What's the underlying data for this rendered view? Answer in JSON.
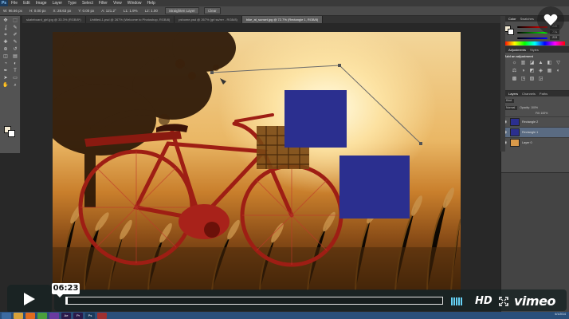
{
  "photoshop": {
    "logo": "Ps",
    "menu": [
      "File",
      "Edit",
      "Image",
      "Layer",
      "Type",
      "Select",
      "Filter",
      "View",
      "Window",
      "Help"
    ],
    "options": {
      "w": "W: 96.66 px",
      "h": "H: 0.00 px",
      "x": "X: 28.63 px",
      "y": "Y: 0.00 px",
      "angle": "A: 121.2°",
      "length": "L1: 1.9%",
      "l2": "L2: 1.00",
      "straighten": "Straighten Layer",
      "clear": "Clear"
    },
    "tabs": [
      "skateboard_girl.jpg @ 33.3% (RGB/8*)",
      "Untitled-1.psd @ 267% (Welcome to Photoshop, RGB/8)",
      "pshome.psd @ 267% (grl ss/rrrr - RGB/8)",
      "bike_at_sunset.jpg @ 72.7% (Rectangle 1, RGB/8)"
    ],
    "active_tab": 3,
    "tool_icons": [
      "move-tool",
      "marquee-tool",
      "lasso-tool",
      "quick-select-tool",
      "crop-tool",
      "eyedropper-tool",
      "healing-tool",
      "brush-tool",
      "stamp-tool",
      "history-brush-tool",
      "eraser-tool",
      "gradient-tool",
      "blur-tool",
      "dodge-tool",
      "pen-tool",
      "type-tool",
      "path-select-tool",
      "shape-tool",
      "hand-tool",
      "zoom-tool"
    ],
    "tool_glyphs": [
      "✥",
      "⬚",
      "ʆ",
      "✎",
      "⌗",
      "✐",
      "✚",
      "✎",
      "⊕",
      "↺",
      "◫",
      "▤",
      "◔",
      "◐",
      "✒",
      "T",
      "➤",
      "▭",
      "✋",
      "⌕"
    ]
  },
  "panels": {
    "color_tab": "Color",
    "swatches_tab": "Swatches",
    "color_values": {
      "r": "245",
      "g": "236",
      "b": "213"
    },
    "adjust_tab": "Adjustments",
    "styles_tab": "Styles",
    "adjust_label": "Add an adjustment",
    "adjust_icons": [
      "☼",
      "▥",
      "◪",
      "▲",
      "◧",
      "▽",
      "⚖",
      "◑",
      "◩",
      "◈",
      "▦",
      "◐",
      "▩",
      "◳",
      "▧",
      "◲"
    ],
    "layers_tab": "Layers",
    "channels_tab": "Channels",
    "paths_tab": "Paths",
    "kind": "Kind",
    "blend": "Normal",
    "opacity": "Opacity: 100%",
    "fill": "Fill: 100%",
    "layers": [
      {
        "name": "Rectangle 2",
        "thumb": "#2b2f8f",
        "selected": false
      },
      {
        "name": "Rectangle 1",
        "thumb": "#2b2f8f",
        "selected": true
      },
      {
        "name": "Layer 0",
        "thumb": "#d99a4a",
        "selected": false
      }
    ]
  },
  "player": {
    "time": "06:23",
    "progress": 0.0,
    "hd": "HD",
    "brand": "vimeo",
    "volume_level": 1.0
  },
  "taskbar": {
    "clock": "6/1/2014",
    "apps": [
      {
        "label": "",
        "color": "#3c6aa0"
      },
      {
        "label": "",
        "color": "#d8a23a"
      },
      {
        "label": "",
        "color": "#e06b1e"
      },
      {
        "label": "",
        "color": "#4aa03c"
      },
      {
        "label": "",
        "color": "#6a3aa0"
      },
      {
        "label": "Ae",
        "color": "#2a1a4a"
      },
      {
        "label": "Pr",
        "color": "#2a1a4a"
      },
      {
        "label": "Ps",
        "color": "#1b3a5c"
      },
      {
        "label": "",
        "color": "#a03030"
      }
    ]
  },
  "colors": {
    "shape_blue": "#2b2f8f",
    "vimeo_blue": "#66d2f6",
    "player_bg": "rgba(23,35,34,0.78)"
  }
}
